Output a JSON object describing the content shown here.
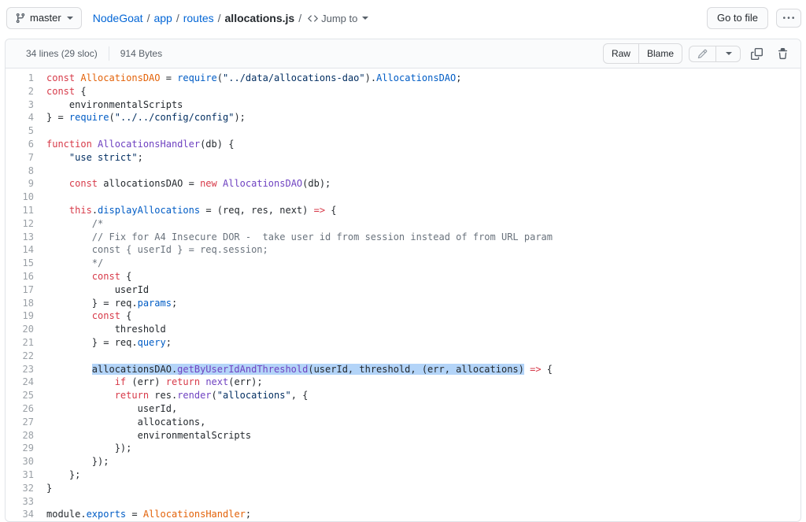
{
  "colors": {
    "link_blue": "#0366d6",
    "text_primary": "#24292e",
    "text_secondary": "#586069",
    "border": "#e1e4e8",
    "btn_border": "#d9dadd",
    "header_bg": "#fafbfc",
    "selection": "#b3d4f8",
    "line_number": "#9aa0a6",
    "tok_keyword": "#d73a49",
    "tok_entity": "#6f42c1",
    "tok_constant": "#005cc5",
    "tok_string": "#032f62",
    "tok_comment": "#6a737d",
    "tok_variable": "#e36209"
  },
  "topbar": {
    "branch_button": {
      "label": "master"
    },
    "breadcrumb": {
      "repo": "NodeGoat",
      "seg1": "app",
      "seg2": "routes",
      "file": "allocations.js",
      "sep": "/"
    },
    "jump_to": {
      "label": "Jump to"
    },
    "go_to_file": "Go to file"
  },
  "file_header": {
    "lines_info": "34 lines (29 sloc)",
    "size_info": "914 Bytes",
    "raw": "Raw",
    "blame": "Blame"
  },
  "code": {
    "lines": [
      [
        {
          "c": "k",
          "t": "const"
        },
        {
          "c": "p",
          "t": " "
        },
        {
          "c": "v",
          "t": "AllocationsDAO"
        },
        {
          "c": "p",
          "t": " = "
        },
        {
          "c": "c1",
          "t": "require"
        },
        {
          "c": "p",
          "t": "("
        },
        {
          "c": "s",
          "t": "\"../data/allocations-dao\""
        },
        {
          "c": "p",
          "t": ")."
        },
        {
          "c": "c1",
          "t": "AllocationsDAO"
        },
        {
          "c": "p",
          "t": ";"
        }
      ],
      [
        {
          "c": "k",
          "t": "const"
        },
        {
          "c": "p",
          "t": " {"
        }
      ],
      [
        {
          "c": "p",
          "t": "    environmentalScripts"
        }
      ],
      [
        {
          "c": "p",
          "t": "} = "
        },
        {
          "c": "c1",
          "t": "require"
        },
        {
          "c": "p",
          "t": "("
        },
        {
          "c": "s",
          "t": "\"../../config/config\""
        },
        {
          "c": "p",
          "t": ");"
        }
      ],
      [],
      [
        {
          "c": "k",
          "t": "function"
        },
        {
          "c": "p",
          "t": " "
        },
        {
          "c": "e",
          "t": "AllocationsHandler"
        },
        {
          "c": "p",
          "t": "(db) {"
        }
      ],
      [
        {
          "c": "p",
          "t": "    "
        },
        {
          "c": "s",
          "t": "\"use strict\""
        },
        {
          "c": "p",
          "t": ";"
        }
      ],
      [],
      [
        {
          "c": "p",
          "t": "    "
        },
        {
          "c": "k",
          "t": "const"
        },
        {
          "c": "p",
          "t": " allocationsDAO = "
        },
        {
          "c": "k",
          "t": "new"
        },
        {
          "c": "p",
          "t": " "
        },
        {
          "c": "e",
          "t": "AllocationsDAO"
        },
        {
          "c": "p",
          "t": "(db);"
        }
      ],
      [],
      [
        {
          "c": "p",
          "t": "    "
        },
        {
          "c": "k",
          "t": "this"
        },
        {
          "c": "p",
          "t": "."
        },
        {
          "c": "c1",
          "t": "displayAllocations"
        },
        {
          "c": "p",
          "t": " = (req, res, next) "
        },
        {
          "c": "k",
          "t": "=>"
        },
        {
          "c": "p",
          "t": " {"
        }
      ],
      [
        {
          "c": "p",
          "t": "        "
        },
        {
          "c": "cm",
          "t": "/*"
        }
      ],
      [
        {
          "c": "p",
          "t": "        "
        },
        {
          "c": "cm",
          "t": "// Fix for A4 Insecure DOR -  take user id from session instead of from URL param"
        }
      ],
      [
        {
          "c": "p",
          "t": "        "
        },
        {
          "c": "cm",
          "t": "const { userId } = req.session;"
        }
      ],
      [
        {
          "c": "p",
          "t": "        "
        },
        {
          "c": "cm",
          "t": "*/"
        }
      ],
      [
        {
          "c": "p",
          "t": "        "
        },
        {
          "c": "k",
          "t": "const"
        },
        {
          "c": "p",
          "t": " {"
        }
      ],
      [
        {
          "c": "p",
          "t": "            userId"
        }
      ],
      [
        {
          "c": "p",
          "t": "        } = req."
        },
        {
          "c": "c1",
          "t": "params"
        },
        {
          "c": "p",
          "t": ";"
        }
      ],
      [
        {
          "c": "p",
          "t": "        "
        },
        {
          "c": "k",
          "t": "const"
        },
        {
          "c": "p",
          "t": " {"
        }
      ],
      [
        {
          "c": "p",
          "t": "            threshold"
        }
      ],
      [
        {
          "c": "p",
          "t": "        } = req."
        },
        {
          "c": "c1",
          "t": "query"
        },
        {
          "c": "p",
          "t": ";"
        }
      ],
      [],
      [
        {
          "c": "p",
          "t": "        "
        },
        {
          "c": "p",
          "t": "allocationsDAO.",
          "sel": true
        },
        {
          "c": "e",
          "t": "getByUserIdAndThreshold",
          "sel": true
        },
        {
          "c": "p",
          "t": "(userId, threshold, (err, allocations)",
          "sel": true
        },
        {
          "c": "p",
          "t": " "
        },
        {
          "c": "k",
          "t": "=>"
        },
        {
          "c": "p",
          "t": " {"
        }
      ],
      [
        {
          "c": "p",
          "t": "            "
        },
        {
          "c": "k",
          "t": "if"
        },
        {
          "c": "p",
          "t": " (err) "
        },
        {
          "c": "k",
          "t": "return"
        },
        {
          "c": "p",
          "t": " "
        },
        {
          "c": "e",
          "t": "next"
        },
        {
          "c": "p",
          "t": "(err);"
        }
      ],
      [
        {
          "c": "p",
          "t": "            "
        },
        {
          "c": "k",
          "t": "return"
        },
        {
          "c": "p",
          "t": " res."
        },
        {
          "c": "e",
          "t": "render"
        },
        {
          "c": "p",
          "t": "("
        },
        {
          "c": "s",
          "t": "\"allocations\""
        },
        {
          "c": "p",
          "t": ", {"
        }
      ],
      [
        {
          "c": "p",
          "t": "                userId,"
        }
      ],
      [
        {
          "c": "p",
          "t": "                allocations,"
        }
      ],
      [
        {
          "c": "p",
          "t": "                environmentalScripts"
        }
      ],
      [
        {
          "c": "p",
          "t": "            });"
        }
      ],
      [
        {
          "c": "p",
          "t": "        });"
        }
      ],
      [
        {
          "c": "p",
          "t": "    };"
        }
      ],
      [
        {
          "c": "p",
          "t": "}"
        }
      ],
      [],
      [
        {
          "c": "p",
          "t": "module."
        },
        {
          "c": "c1",
          "t": "exports"
        },
        {
          "c": "p",
          "t": " = "
        },
        {
          "c": "v",
          "t": "AllocationsHandler"
        },
        {
          "c": "p",
          "t": ";"
        }
      ]
    ]
  }
}
